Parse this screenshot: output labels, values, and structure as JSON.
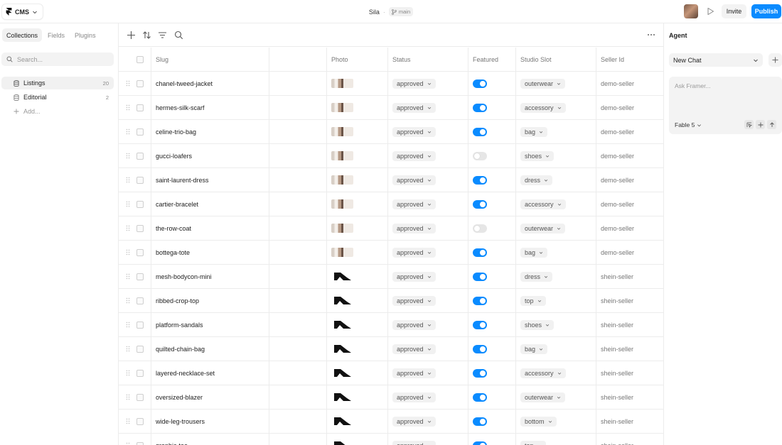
{
  "topbar": {
    "app_menu_label": "CMS",
    "project_name": "Sila",
    "separator": "·",
    "branch": "main",
    "invite_label": "Invite",
    "publish_label": "Publish"
  },
  "sidebar": {
    "tabs": [
      {
        "label": "Collections",
        "active": true
      },
      {
        "label": "Fields",
        "active": false
      },
      {
        "label": "Plugins",
        "active": false
      }
    ],
    "search_placeholder": "Search...",
    "collections": [
      {
        "label": "Listings",
        "count": "20",
        "active": true
      },
      {
        "label": "Editorial",
        "count": "2",
        "active": false
      }
    ],
    "add_label": "Add..."
  },
  "table": {
    "columns": [
      "Slug",
      "Photo",
      "Status",
      "Featured",
      "Studio Slot",
      "Seller Id"
    ],
    "rows": [
      {
        "slug": "chanel-tweed-jacket",
        "photo": "editorial-photo",
        "status": "approved",
        "featured": true,
        "slot": "outerwear",
        "seller": "demo-seller"
      },
      {
        "slug": "hermes-silk-scarf",
        "photo": "editorial-photo",
        "status": "approved",
        "featured": true,
        "slot": "accessory",
        "seller": "demo-seller"
      },
      {
        "slug": "celine-trio-bag",
        "photo": "editorial-photo",
        "status": "approved",
        "featured": true,
        "slot": "bag",
        "seller": "demo-seller"
      },
      {
        "slug": "gucci-loafers",
        "photo": "editorial-photo",
        "status": "approved",
        "featured": false,
        "slot": "shoes",
        "seller": "demo-seller"
      },
      {
        "slug": "saint-laurent-dress",
        "photo": "editorial-photo",
        "status": "approved",
        "featured": true,
        "slot": "dress",
        "seller": "demo-seller"
      },
      {
        "slug": "cartier-bracelet",
        "photo": "editorial-photo",
        "status": "approved",
        "featured": true,
        "slot": "accessory",
        "seller": "demo-seller"
      },
      {
        "slug": "the-row-coat",
        "photo": "editorial-photo",
        "status": "approved",
        "featured": false,
        "slot": "outerwear",
        "seller": "demo-seller"
      },
      {
        "slug": "bottega-tote",
        "photo": "editorial-photo",
        "status": "approved",
        "featured": true,
        "slot": "bag",
        "seller": "demo-seller"
      },
      {
        "slug": "mesh-bodycon-mini",
        "photo": "black-silhouette",
        "status": "approved",
        "featured": true,
        "slot": "dress",
        "seller": "shein-seller"
      },
      {
        "slug": "ribbed-crop-top",
        "photo": "black-silhouette",
        "status": "approved",
        "featured": true,
        "slot": "top",
        "seller": "shein-seller"
      },
      {
        "slug": "platform-sandals",
        "photo": "black-silhouette",
        "status": "approved",
        "featured": true,
        "slot": "shoes",
        "seller": "shein-seller"
      },
      {
        "slug": "quilted-chain-bag",
        "photo": "black-silhouette",
        "status": "approved",
        "featured": true,
        "slot": "bag",
        "seller": "shein-seller"
      },
      {
        "slug": "layered-necklace-set",
        "photo": "black-silhouette",
        "status": "approved",
        "featured": true,
        "slot": "accessory",
        "seller": "shein-seller"
      },
      {
        "slug": "oversized-blazer",
        "photo": "black-silhouette",
        "status": "approved",
        "featured": true,
        "slot": "outerwear",
        "seller": "shein-seller"
      },
      {
        "slug": "wide-leg-trousers",
        "photo": "black-silhouette",
        "status": "approved",
        "featured": true,
        "slot": "bottom",
        "seller": "shein-seller"
      },
      {
        "slug": "graphic-tee",
        "photo": "black-silhouette",
        "status": "approved",
        "featured": true,
        "slot": "top",
        "seller": "shein-seller"
      }
    ]
  },
  "agent": {
    "title": "Agent",
    "chat_select": "New Chat",
    "prompt_placeholder": "Ask Framer...",
    "model": "Fable 5"
  },
  "colors": {
    "accent": "#0a8bff",
    "border": "#ececec",
    "pill_bg": "#f1f1f1"
  }
}
